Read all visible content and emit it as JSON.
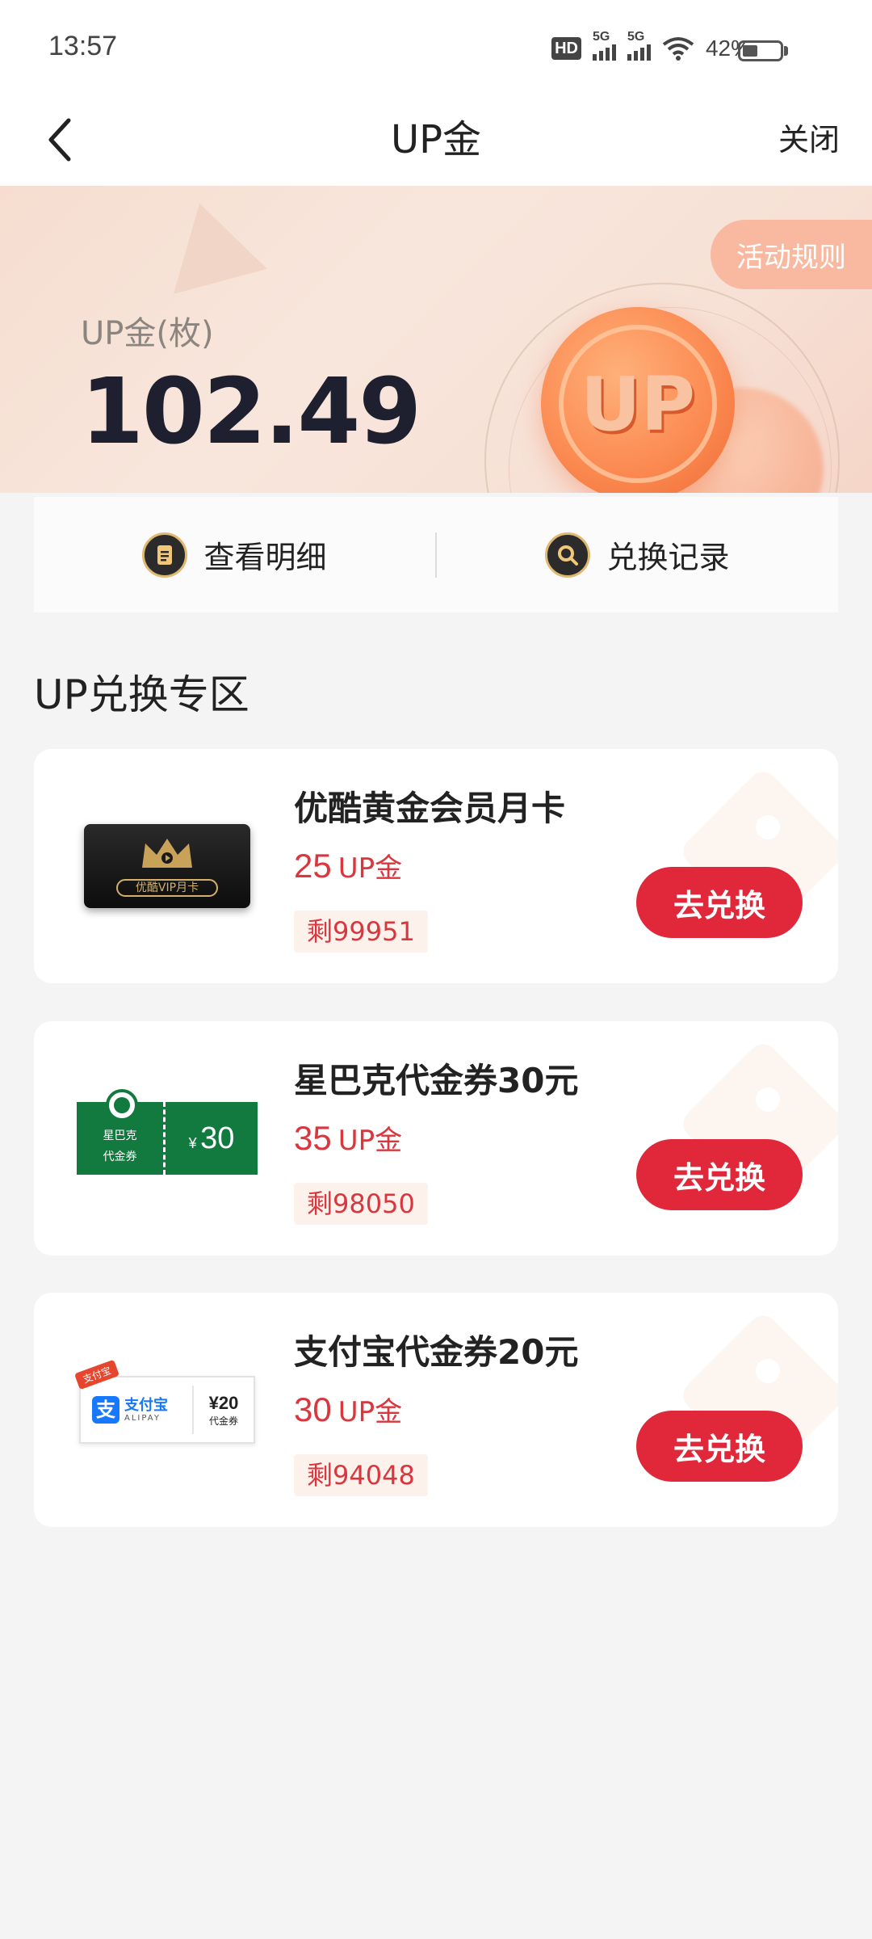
{
  "status_bar": {
    "time": "13:57",
    "hd_label": "HD",
    "network_1": "5G",
    "network_2": "5G",
    "battery": "42%",
    "battery_level": 0.42
  },
  "nav": {
    "back_icon": "chevron-left-icon",
    "title": "UP金",
    "close_label": "关闭"
  },
  "hero": {
    "rules_label": "活动规则",
    "balance_label": "UP金(枚)",
    "balance_value": "102.49",
    "coin_text": "UP"
  },
  "quick_actions": [
    {
      "label": "查看明细",
      "icon": "document-icon"
    },
    {
      "label": "兑换记录",
      "icon": "search-icon"
    }
  ],
  "section_title": "UP兑换专区",
  "products": [
    {
      "title": "优酷黄金会员月卡",
      "price": "25",
      "unit": "UP金",
      "stock": "剩99951",
      "button": "去兑换",
      "image_text": "优酷VIP月卡"
    },
    {
      "title": "星巴克代金券30元",
      "price": "35",
      "unit": "UP金",
      "stock": "剩98050",
      "button": "去兑换",
      "image_text_1": "星巴克",
      "image_text_2": "代金券",
      "image_currency": "¥",
      "image_amount": "30"
    },
    {
      "title": "支付宝代金券20元",
      "price": "30",
      "unit": "UP金",
      "stock": "剩94048",
      "button": "去兑换",
      "image_ribbon": "支付宝",
      "image_brand": "支付宝",
      "image_brand_sub": "ALIPAY",
      "image_amount": "¥20",
      "image_amount_text": "代金券"
    }
  ],
  "colors": {
    "accent_red": "#e0283a",
    "price_red": "#d9363e",
    "coin_orange": "#fb8b52"
  }
}
